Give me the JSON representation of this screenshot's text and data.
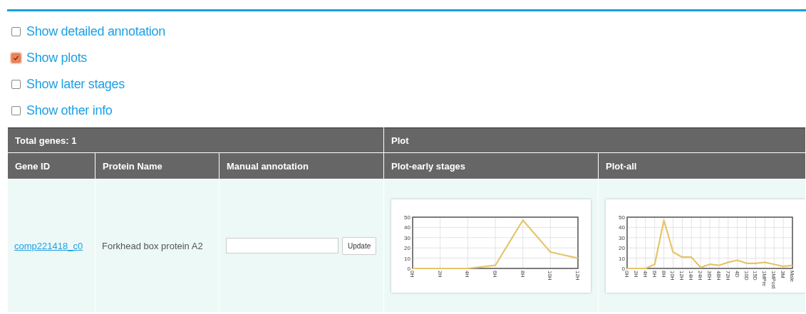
{
  "options": [
    {
      "label": "Show detailed annotation",
      "checked": false
    },
    {
      "label": "Show plots",
      "checked": true
    },
    {
      "label": "Show later stages",
      "checked": false
    },
    {
      "label": "Show other info",
      "checked": false
    }
  ],
  "table": {
    "group_headers": [
      "Total genes: 1",
      "Plot"
    ],
    "columns": [
      "Gene ID",
      "Protein Name",
      "Manual annotation",
      "Plot-early stages",
      "Plot-all"
    ],
    "rows": [
      {
        "gene_id": "comp221418_c0",
        "protein_name": "Forkhead box protein A2",
        "annotation": {
          "button": "Update"
        },
        "plots": [
          {
            "chart_data": {
              "type": "line",
              "grid": true,
              "categories": [
                "0H",
                "2H",
                "4H",
                "6H",
                "8H",
                "10H",
                "12H"
              ],
              "series": [
                {
                  "color": "#e6c46a",
                  "values": [
                    0,
                    0,
                    0,
                    3,
                    47,
                    16,
                    10
                  ]
                }
              ],
              "ylim": [
                0,
                50
              ],
              "yticks": [
                0,
                10,
                20,
                30,
                40,
                50
              ]
            }
          },
          {
            "chart_data": {
              "type": "line",
              "grid": true,
              "categories": [
                "0H",
                "2H",
                "4H",
                "6H",
                "8H",
                "10H",
                "12H",
                "14H",
                "24H",
                "36H",
                "48H",
                "72H",
                "4D",
                "10D",
                "15D",
                "1MPre",
                "1MPost",
                "3M",
                "Male"
              ],
              "series": [
                {
                  "color": "#e6c46a",
                  "values": [
                    0,
                    0,
                    0,
                    4,
                    47,
                    16,
                    11,
                    11,
                    1,
                    4,
                    3,
                    6,
                    8,
                    5,
                    5,
                    6,
                    4,
                    2,
                    3
                  ]
                }
              ],
              "ylim": [
                0,
                50
              ],
              "yticks": [
                0,
                10,
                20,
                30,
                40,
                50
              ]
            }
          }
        ]
      }
    ]
  }
}
